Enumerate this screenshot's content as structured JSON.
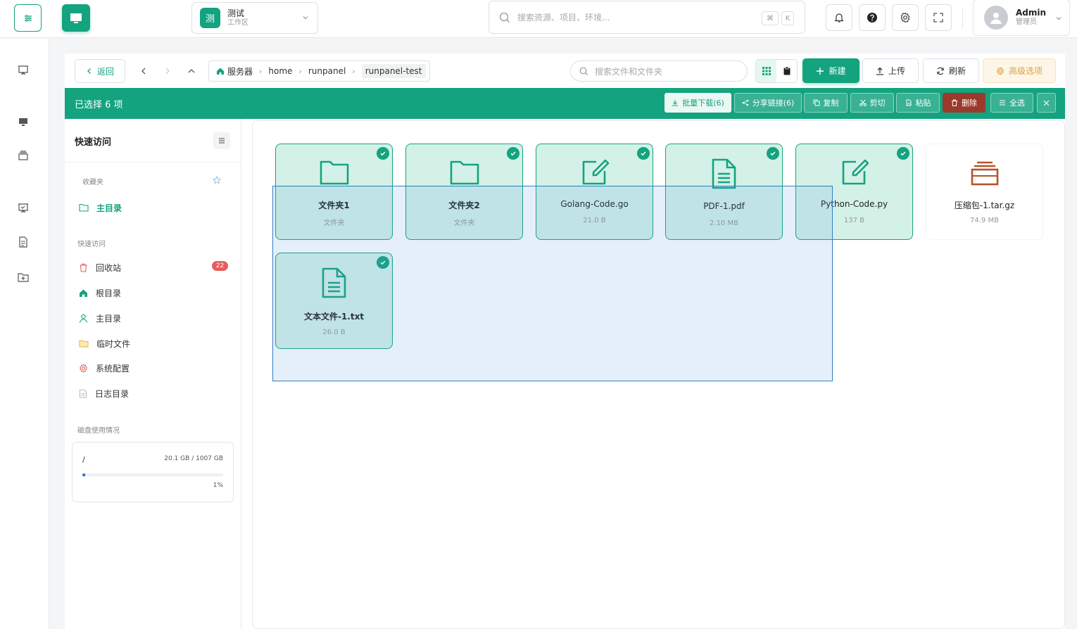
{
  "header": {
    "workspace": {
      "avatar": "测",
      "name": "测试",
      "sub": "工作区"
    },
    "search_placeholder": "搜索资源、项目、环境...",
    "kbd": [
      "⌘",
      "K"
    ],
    "user": {
      "name": "Admin",
      "role": "管理员"
    }
  },
  "toolbar": {
    "back": "返回",
    "breadcrumb": [
      "服务器",
      "home",
      "runpanel",
      "runpanel-test"
    ],
    "search_placeholder": "搜索文件和文件夹",
    "new": "新建",
    "upload": "上传",
    "refresh": "刷新",
    "advanced": "高级选项"
  },
  "selection": {
    "count_label": "已选择 6 项",
    "actions": [
      "批量下载(6)",
      "分享链接(6)",
      "复制",
      "剪切",
      "粘贴",
      "删除",
      "全选"
    ]
  },
  "sidebar": {
    "title": "快速访问",
    "favorites_label": "收藏夹",
    "favorites": [
      {
        "label": "主目录"
      }
    ],
    "quick_label": "快速访问",
    "quick": [
      {
        "label": "回收站"
      },
      {
        "label": "根目录"
      },
      {
        "label": "主目录"
      },
      {
        "label": "临时文件"
      },
      {
        "label": "系统配置"
      },
      {
        "label": "日志目录"
      }
    ],
    "trash_count": "22",
    "disk_label": "磁盘使用情况",
    "disk": {
      "mount": "/",
      "usage": "20.1 GB / 1007 GB",
      "percent": "1%",
      "fraction": 0.02
    }
  },
  "files": [
    {
      "name": "文件夹1",
      "meta": "文件夹",
      "icon": "folder-icon",
      "selected": true
    },
    {
      "name": "文件夹2",
      "meta": "文件夹",
      "icon": "folder-icon",
      "selected": true
    },
    {
      "name": "Golang-Code.go",
      "meta": "21.0 B",
      "icon": "code-edit-icon",
      "selected": true
    },
    {
      "name": "PDF-1.pdf",
      "meta": "2.10 MB",
      "icon": "document-icon",
      "selected": true
    },
    {
      "name": "Python-Code.py",
      "meta": "137 B",
      "icon": "code-edit-icon",
      "selected": true
    },
    {
      "name": "压缩包-1.tar.gz",
      "meta": "74.9 MB",
      "icon": "archive-icon",
      "selected": false
    },
    {
      "name": "文本文件-1.txt",
      "meta": "26.0 B",
      "icon": "document-icon",
      "selected": true
    }
  ],
  "colors": {
    "accent": "#14a37f",
    "danger": "#9b3a2b",
    "warning": "#e0a03a"
  }
}
